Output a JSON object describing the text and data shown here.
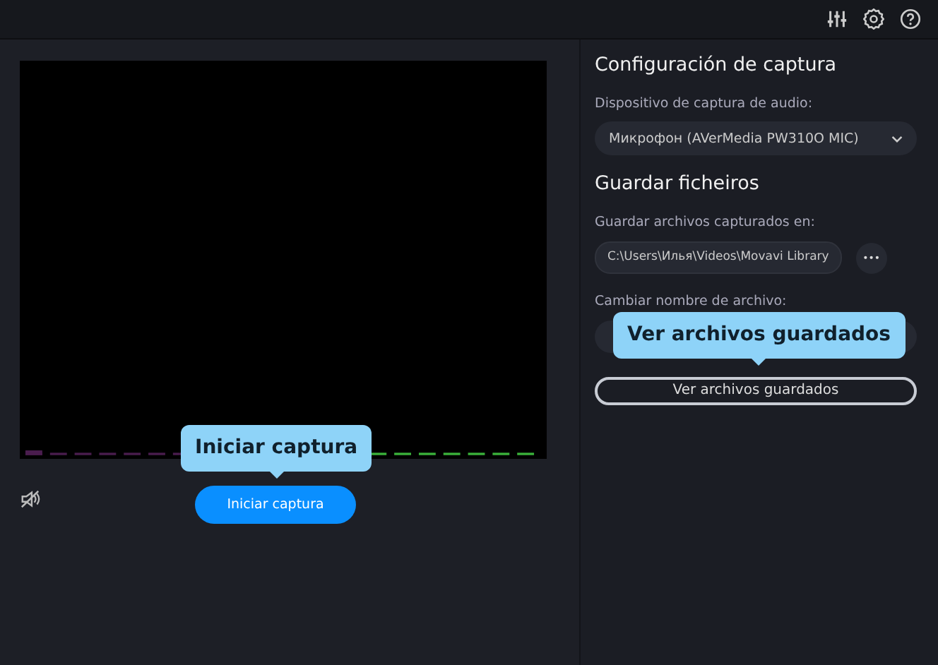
{
  "toolbar": {
    "icons": [
      {
        "kind": "mixer"
      },
      {
        "kind": "settings"
      },
      {
        "kind": "help"
      }
    ]
  },
  "capture": {
    "start_button": "Iniciar captura",
    "muted": true
  },
  "settings": {
    "title": "Configuración de captura",
    "device_label": "Dispositivo de captura de audio:",
    "device_value": "Микрофон (AVerMedia PW310O MIC)"
  },
  "save": {
    "title": "Guardar ficheiros",
    "path_label": "Guardar archivos capturados en:",
    "path_value": "C:\\Users\\Илья\\Videos\\Movavi Library",
    "more_button": "•••",
    "rename_label": "Cambiar nombre de archivo:",
    "view_button": "Ver archivos guardados"
  },
  "tooltips": [
    {
      "text": "Iniciar captura"
    },
    {
      "text": "Ver archivos guardados"
    }
  ]
}
